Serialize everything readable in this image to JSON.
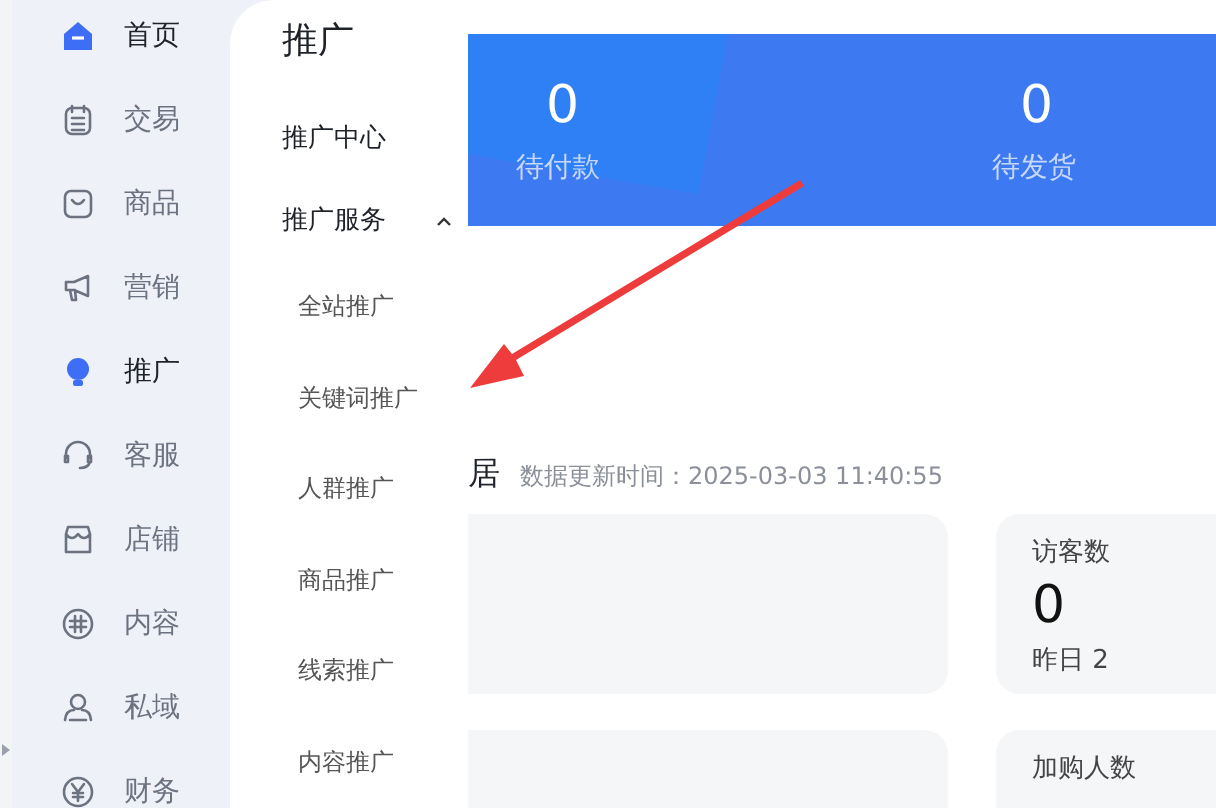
{
  "sidebar": {
    "items": [
      {
        "label": "首页",
        "active": true
      },
      {
        "label": "交易",
        "active": false
      },
      {
        "label": "商品",
        "active": false
      },
      {
        "label": "营销",
        "active": false
      },
      {
        "label": "推广",
        "active": true
      },
      {
        "label": "客服",
        "active": false
      },
      {
        "label": "店铺",
        "active": false
      },
      {
        "label": "内容",
        "active": false
      },
      {
        "label": "私域",
        "active": false
      },
      {
        "label": "财务",
        "active": false
      }
    ]
  },
  "submenu": {
    "title": "推广",
    "items": [
      {
        "label": "推广中心"
      },
      {
        "label": "推广服务",
        "expanded": true,
        "children": [
          {
            "label": "全站推广"
          },
          {
            "label": "关键词推广"
          },
          {
            "label": "人群推广"
          },
          {
            "label": "商品推广"
          },
          {
            "label": "线索推广"
          },
          {
            "label": "内容推广"
          }
        ]
      }
    ]
  },
  "banner": {
    "stats": [
      {
        "value": "0",
        "label": "待付款"
      },
      {
        "value": "0",
        "label": "待发货"
      }
    ]
  },
  "data_section": {
    "heading": "居",
    "updated": "数据更新时间：2025-03-03 11:40:55",
    "cards": [
      {
        "kind": "blank"
      },
      {
        "kind": "metric",
        "title": "访客数",
        "value": "0",
        "compare": "昨日 2"
      },
      {
        "kind": "blank"
      },
      {
        "kind": "metric",
        "title": "加购人数"
      }
    ]
  }
}
